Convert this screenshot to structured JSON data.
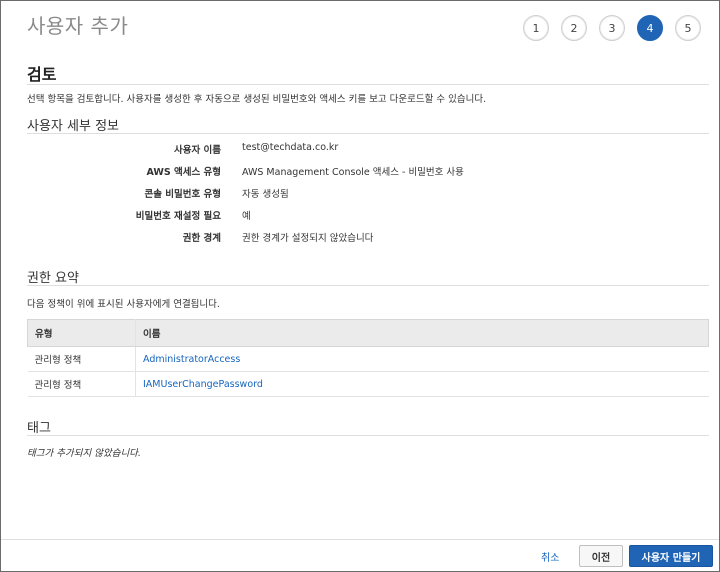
{
  "header": {
    "title": "사용자 추가",
    "steps": [
      "1",
      "2",
      "3",
      "4",
      "5"
    ],
    "active_step": "4"
  },
  "review": {
    "title": "검토",
    "description": "선택 항목을 검토합니다. 사용자를 생성한 후 자동으로 생성된 비밀번호와 액세스 키를 보고 다운로드할 수 있습니다."
  },
  "user_details": {
    "title": "사용자 세부 정보",
    "rows": [
      {
        "label": "사용자 이름",
        "value": "test@techdata.co.kr"
      },
      {
        "label": "AWS 액세스 유형",
        "value": "AWS Management Console 액세스 - 비밀번호 사용"
      },
      {
        "label": "콘솔 비밀번호 유형",
        "value": "자동 생성됨"
      },
      {
        "label": "비밀번호 재설정 필요",
        "value": "예"
      },
      {
        "label": "권한 경계",
        "value": "권한 경계가 설정되지 않았습니다"
      }
    ]
  },
  "permissions": {
    "title": "권한 요약",
    "description": "다음 정책이 위에 표시된 사용자에게 연결됩니다.",
    "columns": [
      "유형",
      "이름"
    ],
    "rows": [
      {
        "type": "관리형 정책",
        "name": "AdministratorAccess"
      },
      {
        "type": "관리형 정책",
        "name": "IAMUserChangePassword"
      }
    ]
  },
  "tags": {
    "title": "태그",
    "empty_text": "태그가 추가되지 않았습니다."
  },
  "footer": {
    "cancel_label": "취소",
    "previous_label": "이전",
    "create_label": "사용자 만들기"
  }
}
